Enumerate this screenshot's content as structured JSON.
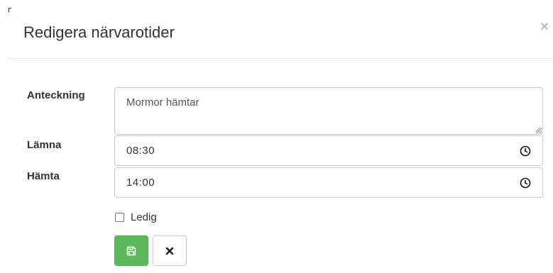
{
  "dialog": {
    "title": "Redigera närvarotider",
    "close_symbol": "×"
  },
  "form": {
    "note": {
      "label": "Anteckning",
      "value": "Mormor hämtar"
    },
    "drop_off": {
      "label": "Lämna",
      "value": "08:30",
      "icon": "clock-icon"
    },
    "pick_up": {
      "label": "Hämta",
      "value": "14:00",
      "icon": "clock-icon"
    },
    "day_off": {
      "label": "Ledig",
      "checked": false
    }
  },
  "actions": {
    "save_icon": "floppy-disk-icon",
    "cancel_icon": "close-x-icon"
  },
  "colors": {
    "save_button": "#5cb85c",
    "text": "#333333",
    "border": "#cccccc"
  }
}
